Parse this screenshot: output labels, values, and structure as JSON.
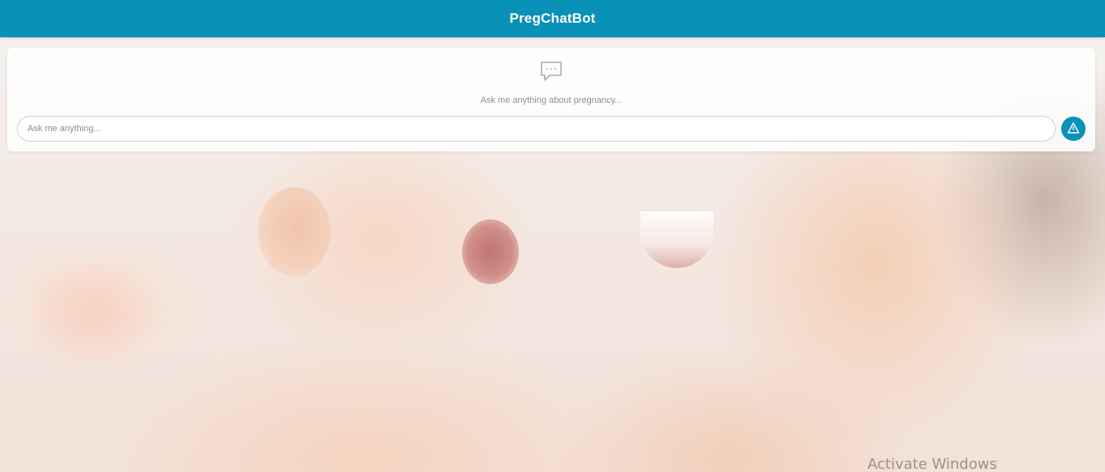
{
  "app": {
    "title": "PregChatBot"
  },
  "chat": {
    "empty_icon": "chat-bubble-icon",
    "empty_message": "Ask me anything about pregnancy...",
    "input_placeholder": "Ask me anything...",
    "input_value": "",
    "send_icon": "send-triangle-icon"
  },
  "background": {
    "description_icon": "mother-baby-photo"
  },
  "colors": {
    "header": "#0a91b8",
    "send_button": "#0a91b8"
  },
  "os_overlay": {
    "watermark_text": "Activate Windows"
  }
}
